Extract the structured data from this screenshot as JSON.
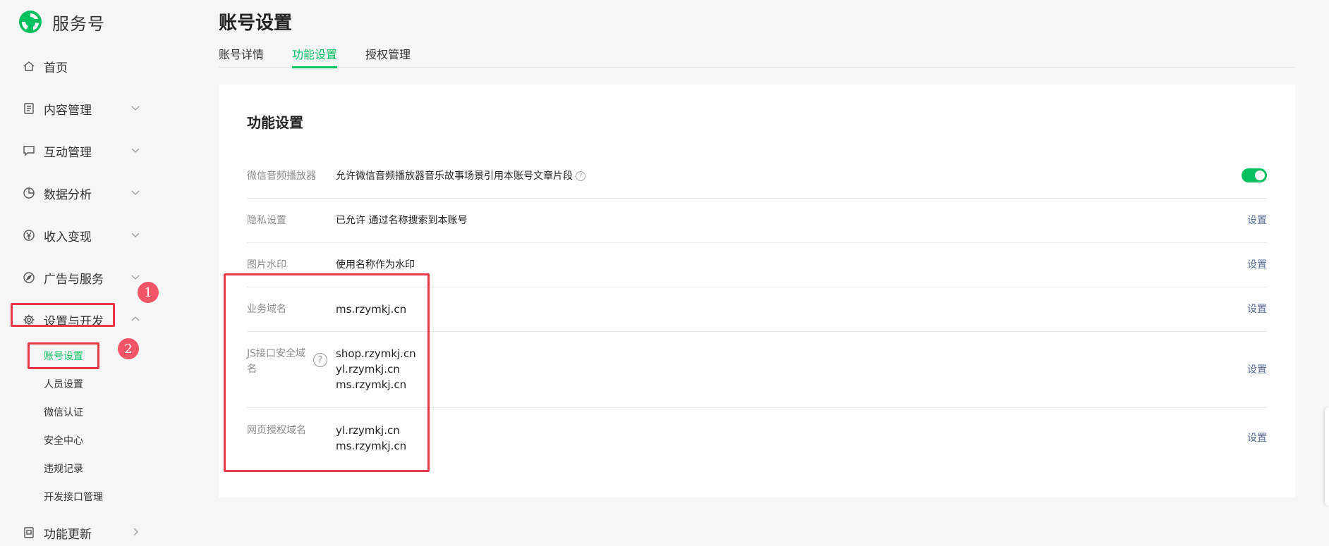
{
  "brand": {
    "name": "服务号"
  },
  "page": {
    "title": "账号设置"
  },
  "sidebar": {
    "items": [
      {
        "label": "首页",
        "icon": "home-icon"
      },
      {
        "label": "内容管理",
        "icon": "document-icon"
      },
      {
        "label": "互动管理",
        "icon": "chat-icon"
      },
      {
        "label": "数据分析",
        "icon": "pie-chart-icon"
      },
      {
        "label": "收入变现",
        "icon": "yen-icon"
      },
      {
        "label": "广告与服务",
        "icon": "compass-icon"
      },
      {
        "label": "设置与开发",
        "icon": "gear-icon"
      },
      {
        "label": "功能更新",
        "icon": "update-icon"
      }
    ],
    "sub_items": [
      {
        "label": "账号设置"
      },
      {
        "label": "人员设置"
      },
      {
        "label": "微信认证"
      },
      {
        "label": "安全中心"
      },
      {
        "label": "违规记录"
      },
      {
        "label": "开发接口管理"
      }
    ]
  },
  "annotations": {
    "badge1": "1",
    "badge2": "2"
  },
  "tabs": [
    {
      "label": "账号详情"
    },
    {
      "label": "功能设置"
    },
    {
      "label": "授权管理"
    }
  ],
  "card": {
    "title": "功能设置",
    "rows": {
      "audio": {
        "label": "微信音频播放器",
        "value": "允许微信音频播放器音乐故事场景引用本账号文章片段"
      },
      "privacy": {
        "label": "隐私设置",
        "value": "已允许 通过名称搜索到本账号",
        "action": "设置"
      },
      "watermark": {
        "label": "图片水印",
        "value": "使用名称作为水印",
        "action": "设置"
      },
      "business": {
        "label": "业务域名",
        "value": "ms.rzymkj.cn",
        "action": "设置"
      },
      "js": {
        "label_line1": "JS接口安全域",
        "label_line2": "名",
        "values": [
          "shop.rzymkj.cn",
          "yl.rzymkj.cn",
          "ms.rzymkj.cn"
        ],
        "action": "设置"
      },
      "oauth": {
        "label": "网页授权域名",
        "values": [
          "yl.rzymkj.cn",
          "ms.rzymkj.cn"
        ],
        "action": "设置"
      }
    },
    "help_glyph": "?"
  },
  "colors": {
    "accent": "#07c160",
    "link": "#576b95",
    "annotation": "#e73a48"
  }
}
